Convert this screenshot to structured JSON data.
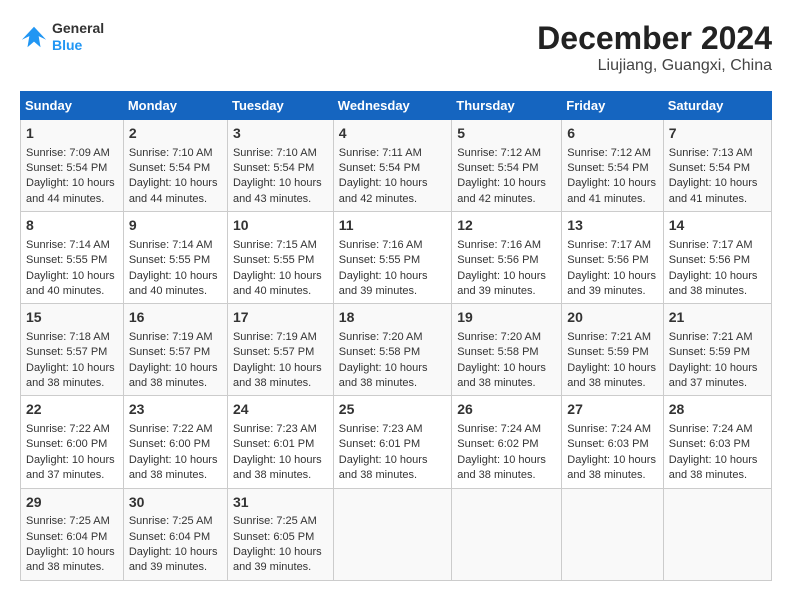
{
  "logo": {
    "line1": "General",
    "line2": "Blue"
  },
  "title": "December 2024",
  "subtitle": "Liujiang, Guangxi, China",
  "days_of_week": [
    "Sunday",
    "Monday",
    "Tuesday",
    "Wednesday",
    "Thursday",
    "Friday",
    "Saturday"
  ],
  "weeks": [
    [
      {
        "day": "1",
        "sunrise": "7:09 AM",
        "sunset": "5:54 PM",
        "daylight": "10 hours and 44 minutes."
      },
      {
        "day": "2",
        "sunrise": "7:10 AM",
        "sunset": "5:54 PM",
        "daylight": "10 hours and 44 minutes."
      },
      {
        "day": "3",
        "sunrise": "7:10 AM",
        "sunset": "5:54 PM",
        "daylight": "10 hours and 43 minutes."
      },
      {
        "day": "4",
        "sunrise": "7:11 AM",
        "sunset": "5:54 PM",
        "daylight": "10 hours and 42 minutes."
      },
      {
        "day": "5",
        "sunrise": "7:12 AM",
        "sunset": "5:54 PM",
        "daylight": "10 hours and 42 minutes."
      },
      {
        "day": "6",
        "sunrise": "7:12 AM",
        "sunset": "5:54 PM",
        "daylight": "10 hours and 41 minutes."
      },
      {
        "day": "7",
        "sunrise": "7:13 AM",
        "sunset": "5:54 PM",
        "daylight": "10 hours and 41 minutes."
      }
    ],
    [
      {
        "day": "8",
        "sunrise": "7:14 AM",
        "sunset": "5:55 PM",
        "daylight": "10 hours and 40 minutes."
      },
      {
        "day": "9",
        "sunrise": "7:14 AM",
        "sunset": "5:55 PM",
        "daylight": "10 hours and 40 minutes."
      },
      {
        "day": "10",
        "sunrise": "7:15 AM",
        "sunset": "5:55 PM",
        "daylight": "10 hours and 40 minutes."
      },
      {
        "day": "11",
        "sunrise": "7:16 AM",
        "sunset": "5:55 PM",
        "daylight": "10 hours and 39 minutes."
      },
      {
        "day": "12",
        "sunrise": "7:16 AM",
        "sunset": "5:56 PM",
        "daylight": "10 hours and 39 minutes."
      },
      {
        "day": "13",
        "sunrise": "7:17 AM",
        "sunset": "5:56 PM",
        "daylight": "10 hours and 39 minutes."
      },
      {
        "day": "14",
        "sunrise": "7:17 AM",
        "sunset": "5:56 PM",
        "daylight": "10 hours and 38 minutes."
      }
    ],
    [
      {
        "day": "15",
        "sunrise": "7:18 AM",
        "sunset": "5:57 PM",
        "daylight": "10 hours and 38 minutes."
      },
      {
        "day": "16",
        "sunrise": "7:19 AM",
        "sunset": "5:57 PM",
        "daylight": "10 hours and 38 minutes."
      },
      {
        "day": "17",
        "sunrise": "7:19 AM",
        "sunset": "5:57 PM",
        "daylight": "10 hours and 38 minutes."
      },
      {
        "day": "18",
        "sunrise": "7:20 AM",
        "sunset": "5:58 PM",
        "daylight": "10 hours and 38 minutes."
      },
      {
        "day": "19",
        "sunrise": "7:20 AM",
        "sunset": "5:58 PM",
        "daylight": "10 hours and 38 minutes."
      },
      {
        "day": "20",
        "sunrise": "7:21 AM",
        "sunset": "5:59 PM",
        "daylight": "10 hours and 38 minutes."
      },
      {
        "day": "21",
        "sunrise": "7:21 AM",
        "sunset": "5:59 PM",
        "daylight": "10 hours and 37 minutes."
      }
    ],
    [
      {
        "day": "22",
        "sunrise": "7:22 AM",
        "sunset": "6:00 PM",
        "daylight": "10 hours and 37 minutes."
      },
      {
        "day": "23",
        "sunrise": "7:22 AM",
        "sunset": "6:00 PM",
        "daylight": "10 hours and 38 minutes."
      },
      {
        "day": "24",
        "sunrise": "7:23 AM",
        "sunset": "6:01 PM",
        "daylight": "10 hours and 38 minutes."
      },
      {
        "day": "25",
        "sunrise": "7:23 AM",
        "sunset": "6:01 PM",
        "daylight": "10 hours and 38 minutes."
      },
      {
        "day": "26",
        "sunrise": "7:24 AM",
        "sunset": "6:02 PM",
        "daylight": "10 hours and 38 minutes."
      },
      {
        "day": "27",
        "sunrise": "7:24 AM",
        "sunset": "6:03 PM",
        "daylight": "10 hours and 38 minutes."
      },
      {
        "day": "28",
        "sunrise": "7:24 AM",
        "sunset": "6:03 PM",
        "daylight": "10 hours and 38 minutes."
      }
    ],
    [
      {
        "day": "29",
        "sunrise": "7:25 AM",
        "sunset": "6:04 PM",
        "daylight": "10 hours and 38 minutes."
      },
      {
        "day": "30",
        "sunrise": "7:25 AM",
        "sunset": "6:04 PM",
        "daylight": "10 hours and 39 minutes."
      },
      {
        "day": "31",
        "sunrise": "7:25 AM",
        "sunset": "6:05 PM",
        "daylight": "10 hours and 39 minutes."
      },
      null,
      null,
      null,
      null
    ]
  ],
  "labels": {
    "sunrise": "Sunrise:",
    "sunset": "Sunset:",
    "daylight": "Daylight:"
  }
}
